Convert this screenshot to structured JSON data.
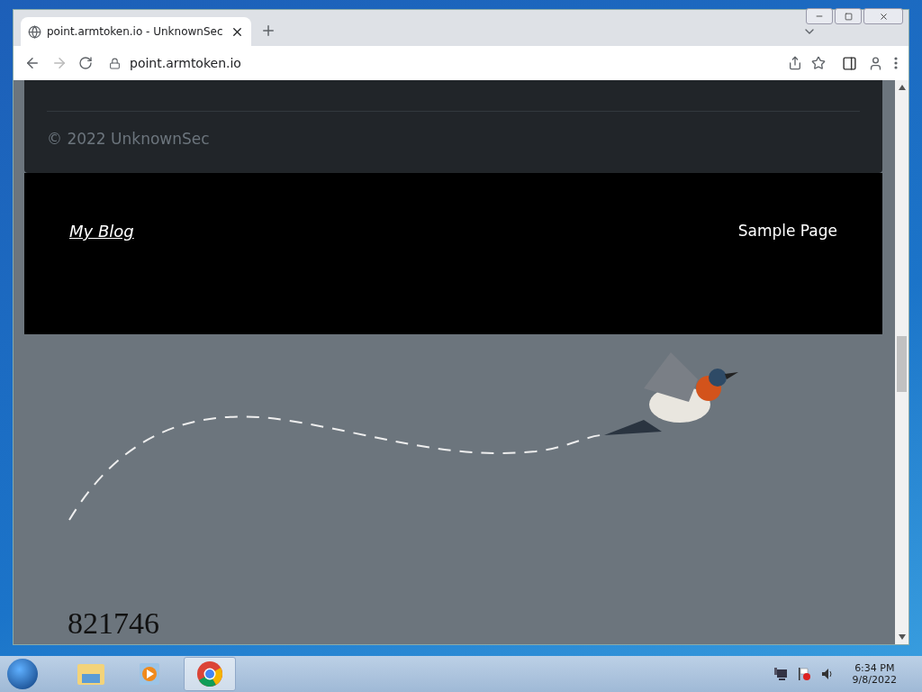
{
  "window": {
    "tab_title": "point.armtoken.io - UnknownSec",
    "url": "point.armtoken.io"
  },
  "footer": {
    "copyright": "© 2022 UnknownSec"
  },
  "site_header": {
    "title": "My Blog",
    "menu": [
      {
        "label": "Sample Page"
      }
    ]
  },
  "hero": {
    "number": "821746"
  },
  "taskbar": {
    "apps": [
      {
        "kind": "explorer",
        "selected": false
      },
      {
        "kind": "media",
        "selected": false
      },
      {
        "kind": "chrome",
        "selected": true
      }
    ],
    "time": "6:34 PM",
    "date": "9/8/2022"
  }
}
